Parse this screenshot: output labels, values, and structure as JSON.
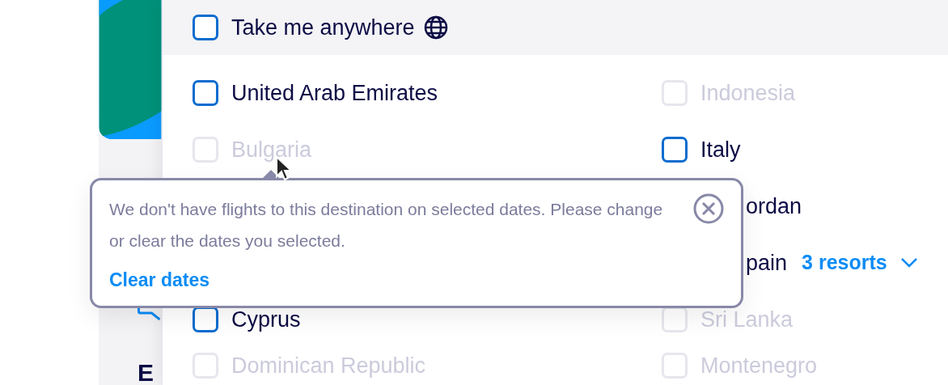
{
  "sidebar": {
    "heading": "E"
  },
  "anywhere": {
    "label": "Take me anywhere",
    "checked": false
  },
  "rows": [
    {
      "left": {
        "label": "United Arab Emirates",
        "checked": false,
        "disabled": false
      },
      "right": {
        "label": "Indonesia",
        "checked": false,
        "disabled": true,
        "kind": "full"
      }
    },
    {
      "left": {
        "label": "Bulgaria",
        "checked": false,
        "disabled": true
      },
      "right": {
        "label": "Italy",
        "checked": false,
        "disabled": false,
        "kind": "full"
      }
    },
    {
      "right": {
        "label": "ordan",
        "disabled": false,
        "kind": "covered"
      }
    },
    {
      "right": {
        "label": "pain",
        "disabled": false,
        "kind": "covered",
        "resorts": "3 resorts"
      }
    },
    {
      "left": {
        "label": "Cyprus",
        "checked": false,
        "disabled": false
      },
      "right": {
        "label": "Sri Lanka",
        "checked": false,
        "disabled": true,
        "kind": "full"
      }
    },
    {
      "left": {
        "label": "Dominican Republic",
        "checked": false,
        "disabled": true
      },
      "right": {
        "label": "Montenegro",
        "checked": false,
        "disabled": true,
        "kind": "full"
      }
    }
  ],
  "tooltip": {
    "message": "We don't have flights to this destination on selected dates. Please change or clear the dates you selected.",
    "action": "Clear dates"
  }
}
